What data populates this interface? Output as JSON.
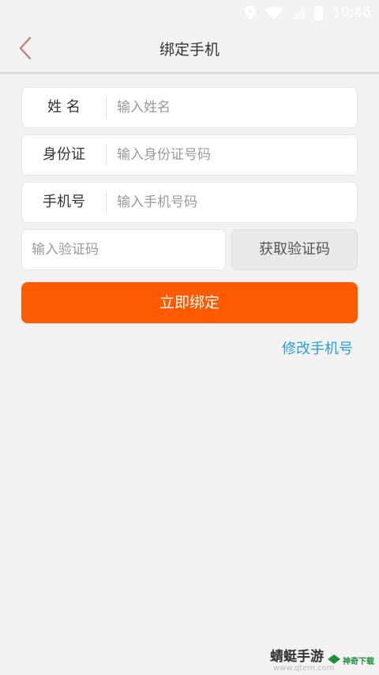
{
  "status_bar": {
    "time": "10:46",
    "icons": [
      "location-icon",
      "wifi-icon",
      "signal-icon",
      "battery-icon"
    ]
  },
  "nav": {
    "title": "绑定手机",
    "back_icon": "chevron-left-icon",
    "back_color": "#b98b8b"
  },
  "form": {
    "name": {
      "label": "姓 名",
      "placeholder": "输入姓名"
    },
    "id_card": {
      "label": "身份证",
      "placeholder": "输入身份证号码"
    },
    "phone": {
      "label": "手机号",
      "placeholder": "输入手机号码"
    },
    "code": {
      "placeholder": "输入验证码"
    },
    "get_code_label": "获取验证码",
    "submit_label": "立即绑定",
    "modify_link": "修改手机号"
  },
  "colors": {
    "accent": "#fe5a00",
    "link": "#2a9fe0",
    "background": "#f2f2f2"
  },
  "watermark": {
    "text": "蜻蜓手游",
    "url": "www.qtem.com",
    "badge": "神奇下载"
  }
}
